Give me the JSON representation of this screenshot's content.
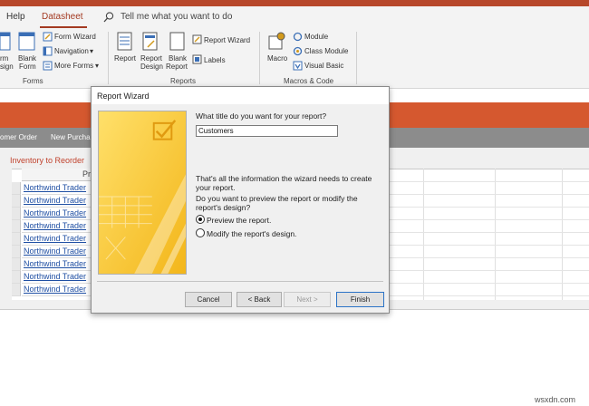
{
  "menu": {
    "help": "Help",
    "datasheet": "Datasheet",
    "tell_me": "Tell me what you want to do"
  },
  "ribbon": {
    "forms_group": {
      "form_partial": "rm",
      "design_partial": "sign",
      "blank_form_1": "Blank",
      "blank_form_2": "Form",
      "form_wizard": "Form Wizard",
      "navigation": "Navigation",
      "more_forms": "More Forms",
      "label": "Forms"
    },
    "reports_group": {
      "report": "Report",
      "report_design_1": "Report",
      "report_design_2": "Design",
      "blank_report_1": "Blank",
      "blank_report_2": "Report",
      "report_wizard": "Report Wizard",
      "labels": "Labels",
      "label": "Reports"
    },
    "macros_group": {
      "macro": "Macro",
      "module": "Module",
      "class_module": "Class Module",
      "visual_basic": "Visual Basic",
      "label": "Macros & Code"
    }
  },
  "doc_tabs": [
    "omer Order",
    "New Purchas"
  ],
  "subform": {
    "title": "Inventory to Reorder",
    "header_partial": "Pr",
    "rows": [
      "Northwind Trader",
      "Northwind Trader",
      "Northwind Trader",
      "Northwind Trader",
      "Northwind Trader",
      "Northwind Trader",
      "Northwind Trader",
      "Northwind Trader",
      "Northwind Trader"
    ]
  },
  "dialog": {
    "title": "Report Wizard",
    "question": "What title do you want for your report?",
    "title_value": "Customers",
    "info": "That's all the information the wizard needs to create your report.",
    "preview_question": "Do you want to preview the report or modify the report's design?",
    "options": {
      "preview": "Preview the report.",
      "modify": "Modify the report's design."
    },
    "selected_option": "preview",
    "buttons": {
      "cancel": "Cancel",
      "back": "< Back",
      "next": "Next >",
      "finish": "Finish"
    }
  },
  "watermark": "wsxdn.com",
  "colors": {
    "accent": "#b7472a",
    "band": "#d5582f",
    "link": "#1f4fa3",
    "wizard_art": "#f5c518"
  }
}
